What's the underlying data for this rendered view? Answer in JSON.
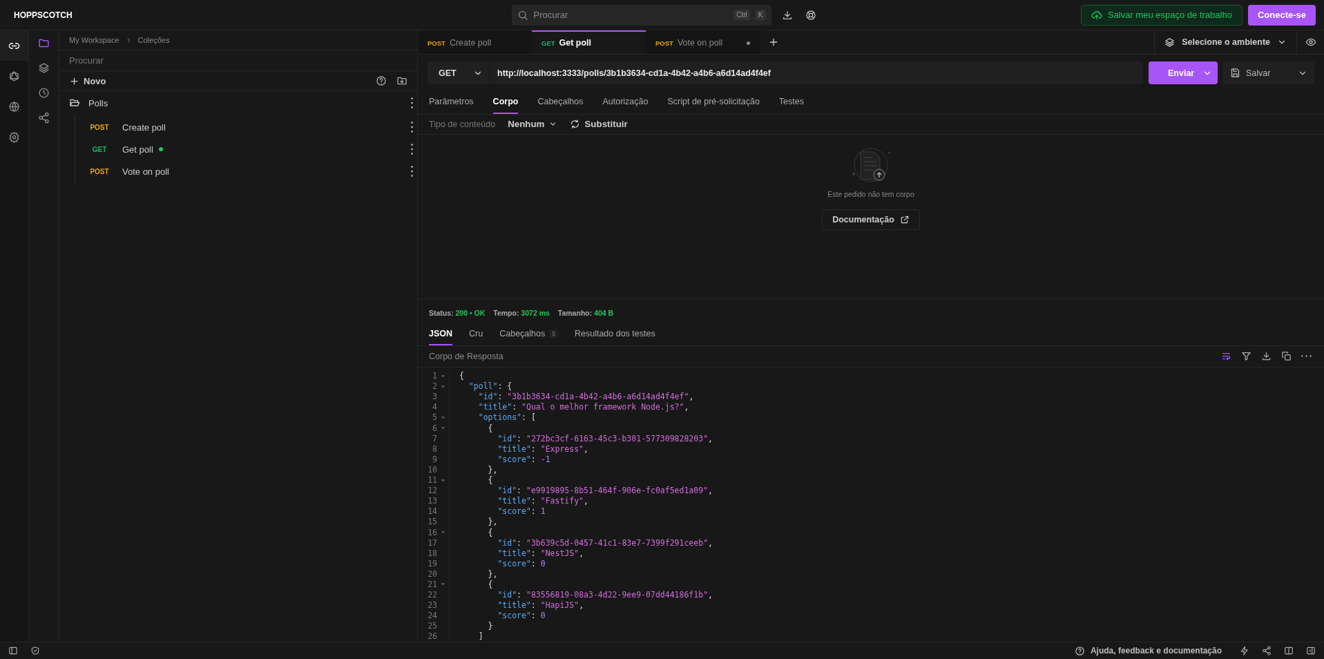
{
  "app": {
    "logo": "HOPPSCOTCH"
  },
  "topbar": {
    "search": {
      "placeholder": "Procurar",
      "shortcut": [
        "Ctrl",
        "K"
      ]
    },
    "save_workspace": "Salvar meu espaço de trabalho",
    "login": "Conecte-se"
  },
  "rail": [
    {
      "selected": true
    },
    {
      "selected": false
    },
    {
      "selected": false
    },
    {
      "selected": false
    }
  ],
  "sub_rail": [
    {
      "selected": true
    },
    {
      "selected": false
    },
    {
      "selected": false
    },
    {
      "selected": false
    }
  ],
  "sidebar": {
    "breadcrumb": [
      "My Workspace",
      "Coleções"
    ],
    "search": {
      "placeholder": "Procurar"
    },
    "new_label": "Novo",
    "collection": {
      "name": "Polls",
      "expanded": true,
      "children": [
        {
          "method": "POST",
          "color": "#e5a50a",
          "name": "Create poll",
          "active": false
        },
        {
          "method": "GET",
          "color": "#1fb36b",
          "name": "Get poll",
          "active": true
        },
        {
          "method": "POST",
          "color": "#e5a50a",
          "name": "Vote on poll",
          "active": false
        }
      ]
    }
  },
  "tabs": [
    {
      "method": "POST",
      "color": "#e5a50a",
      "label": "Create poll",
      "selected": false,
      "unsaved": false
    },
    {
      "method": "GET",
      "color": "#1fb36b",
      "label": "Get poll",
      "selected": true,
      "unsaved": false
    },
    {
      "method": "POST",
      "color": "#e5a50a",
      "label": "Vote on poll",
      "selected": false,
      "unsaved": true
    }
  ],
  "environment": {
    "label": "Selecione o ambiente"
  },
  "request": {
    "method": "GET",
    "url": "http://localhost:3333/polls/3b1b3634-cd1a-4b42-a4b6-a6d14ad4f4ef",
    "send": "Enviar",
    "save": "Salvar",
    "tabs": [
      {
        "label": "Parâmetros",
        "selected": false
      },
      {
        "label": "Corpo",
        "selected": true
      },
      {
        "label": "Cabeçalhos",
        "selected": false
      },
      {
        "label": "Autorização",
        "selected": false
      },
      {
        "label": "Script de pré-solicitação",
        "selected": false
      },
      {
        "label": "Testes",
        "selected": false
      }
    ],
    "content_type": {
      "label": "Tipo de conteúdo",
      "value": "Nenhum",
      "override": "Substituir"
    },
    "empty": {
      "message": "Este pedido não tem corpo",
      "docs": "Documentação"
    }
  },
  "response": {
    "status": [
      {
        "label": "Status:",
        "value": "200  •  OK"
      },
      {
        "label": "Tempo:",
        "value": "3072 ms"
      },
      {
        "label": "Tamanho:",
        "value": "404 B"
      }
    ],
    "tabs": [
      {
        "label": "JSON",
        "selected": true
      },
      {
        "label": "Cru",
        "selected": false
      },
      {
        "label": "Cabeçalhos",
        "selected": false,
        "badge": "5"
      },
      {
        "label": "Resultado dos testes",
        "selected": false
      }
    ],
    "body_label": "Corpo de Resposta",
    "wrap_lines": true,
    "lines": [
      {
        "number": "1",
        "foldable": true,
        "text": "{"
      },
      {
        "number": "2",
        "foldable": true,
        "text": "  \"poll\": {"
      },
      {
        "number": "3",
        "foldable": false,
        "text": "    \"id\": \"3b1b3634-cd1a-4b42-a4b6-a6d14ad4f4ef\","
      },
      {
        "number": "4",
        "foldable": false,
        "text": "    \"title\": \"Qual o melhor framework Node.js?\","
      },
      {
        "number": "5",
        "foldable": true,
        "text": "    \"options\": ["
      },
      {
        "number": "6",
        "foldable": true,
        "text": "      {"
      },
      {
        "number": "7",
        "foldable": false,
        "text": "        \"id\": \"272bc3cf-6163-45c3-b301-577309828203\","
      },
      {
        "number": "8",
        "foldable": false,
        "text": "        \"title\": \"Express\","
      },
      {
        "number": "9",
        "foldable": false,
        "text": "        \"score\": -1"
      },
      {
        "number": "10",
        "foldable": false,
        "text": "      },"
      },
      {
        "number": "11",
        "foldable": true,
        "text": "      {"
      },
      {
        "number": "12",
        "foldable": false,
        "text": "        \"id\": \"e9919895-8b51-464f-906e-fc0af5ed1a09\","
      },
      {
        "number": "13",
        "foldable": false,
        "text": "        \"title\": \"Fastify\","
      },
      {
        "number": "14",
        "foldable": false,
        "text": "        \"score\": 1"
      },
      {
        "number": "15",
        "foldable": false,
        "text": "      },"
      },
      {
        "number": "16",
        "foldable": true,
        "text": "      {"
      },
      {
        "number": "17",
        "foldable": false,
        "text": "        \"id\": \"3b639c5d-0457-41c1-83e7-7399f291ceeb\","
      },
      {
        "number": "18",
        "foldable": false,
        "text": "        \"title\": \"NestJS\","
      },
      {
        "number": "19",
        "foldable": false,
        "text": "        \"score\": 0"
      },
      {
        "number": "20",
        "foldable": false,
        "text": "      },"
      },
      {
        "number": "21",
        "foldable": true,
        "text": "      {"
      },
      {
        "number": "22",
        "foldable": false,
        "text": "        \"id\": \"83556819-08a3-4d22-9ee9-07dd44186f1b\","
      },
      {
        "number": "23",
        "foldable": false,
        "text": "        \"title\": \"HapiJS\","
      },
      {
        "number": "24",
        "foldable": false,
        "text": "        \"score\": 0"
      },
      {
        "number": "25",
        "foldable": false,
        "text": "      }"
      },
      {
        "number": "26",
        "foldable": false,
        "text": "    ]"
      }
    ]
  },
  "footer": {
    "help": "Ajuda, feedback e documentação"
  }
}
